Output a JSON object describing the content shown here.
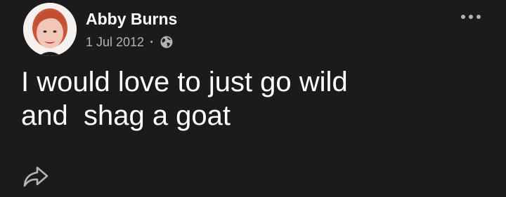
{
  "post": {
    "author": "Abby Burns",
    "date": "1 Jul 2012",
    "separator": "·",
    "privacy_icon": "globe-icon",
    "body": "I would love to just go wild\nand  shag a goat"
  },
  "actions": {
    "more_icon": "more-options-icon",
    "share_icon": "share-icon"
  },
  "colors": {
    "background": "#1b1b1d",
    "primary_text": "#ffffff",
    "secondary_text": "#b3b3b6"
  }
}
